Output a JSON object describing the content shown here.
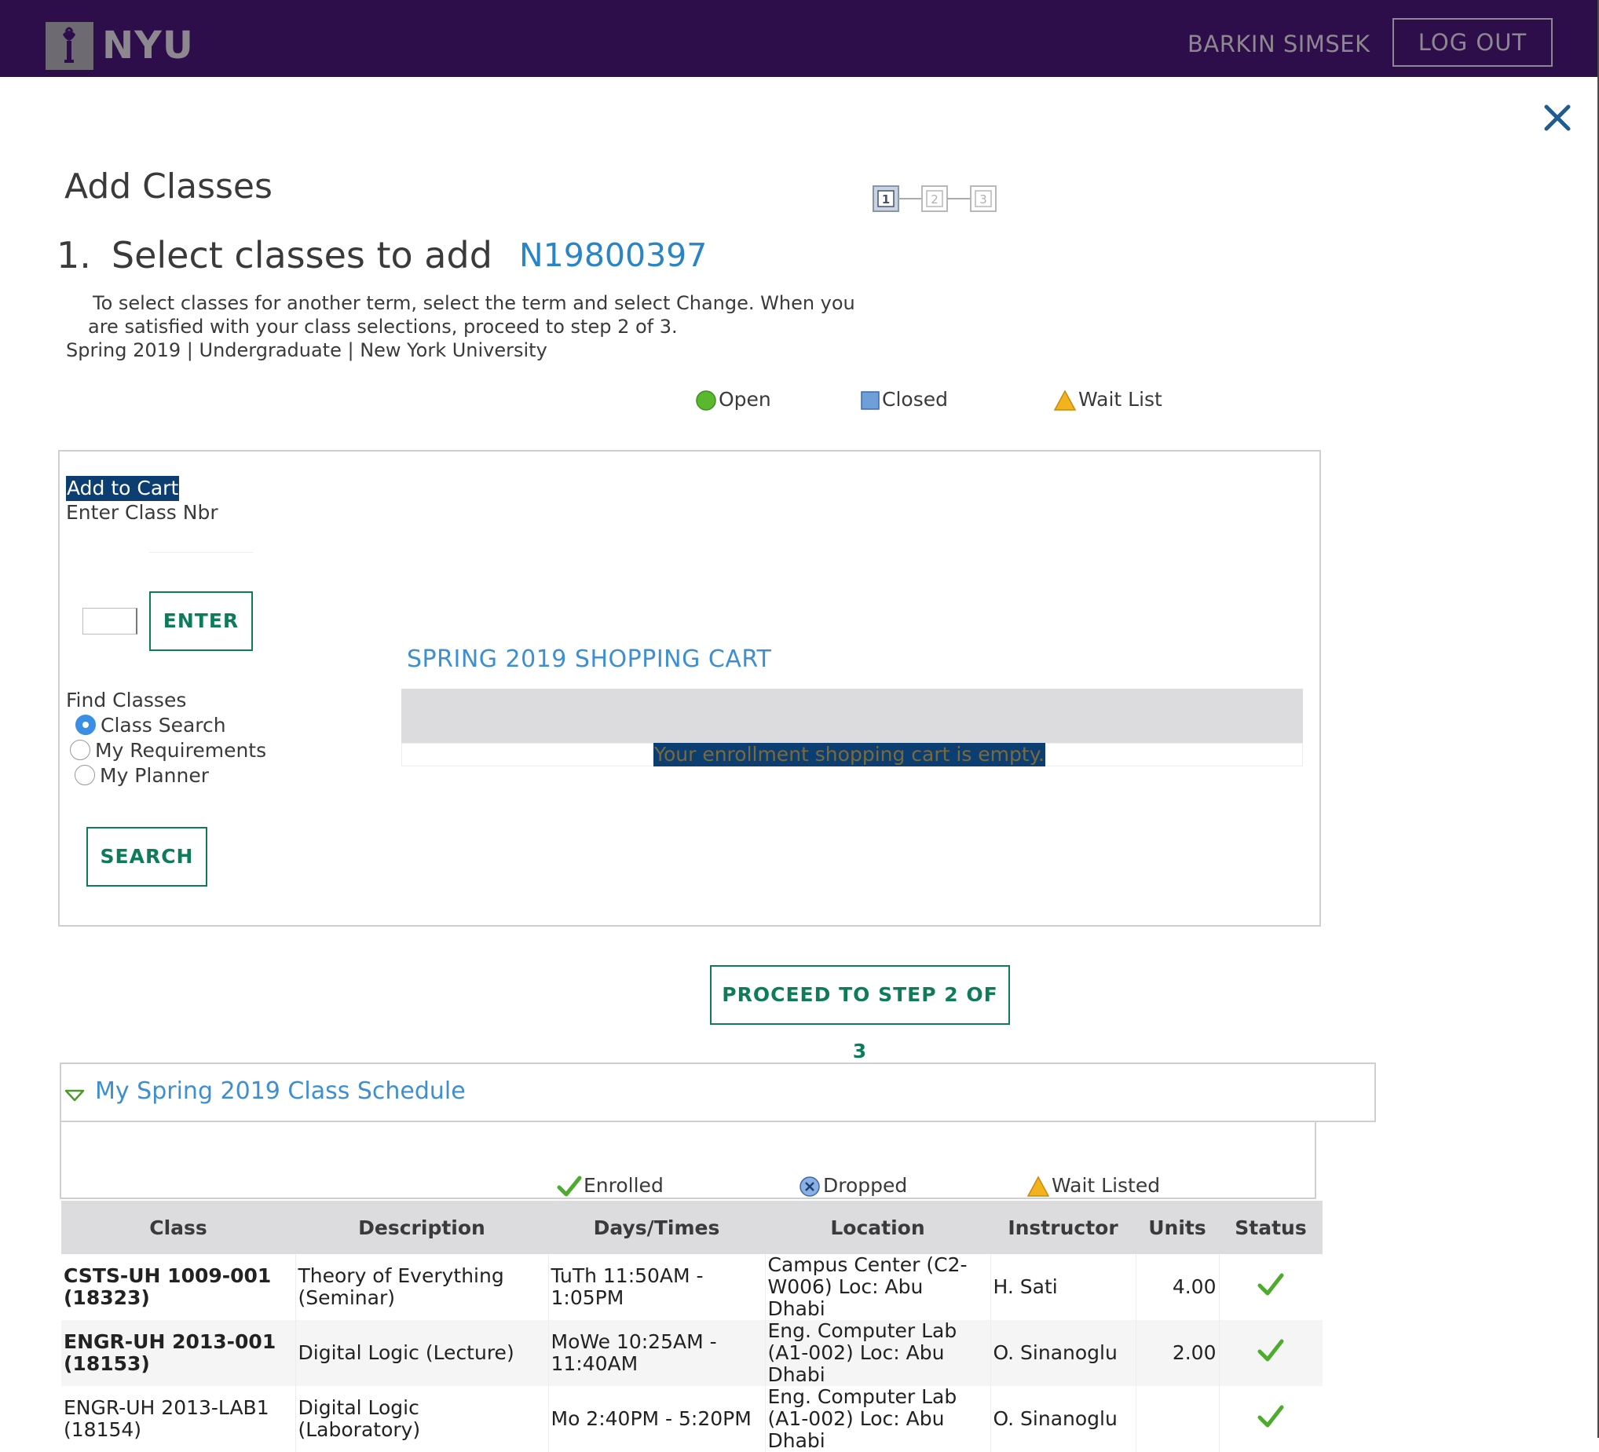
{
  "header": {
    "logo_text": "NYU",
    "user_name": "BARKIN SIMSEK",
    "logout_label": "LOG OUT"
  },
  "page": {
    "title": "Add Classes",
    "step_number": "1.",
    "step_heading": "Select classes to add",
    "student_id": "N19800397",
    "steps": [
      "1",
      "2",
      "3"
    ],
    "current_step": 1,
    "instructions_line1": "To select classes for another term, select the term and select Change.  When you",
    "instructions_line2": "are satisfied with your class selections, proceed to step 2 of 3.",
    "term_line": "Spring 2019 | Undergraduate | New York University"
  },
  "status_legend": {
    "open": "Open",
    "closed": "Closed",
    "wait_list": "Wait List",
    "open_color": "#5ab82e",
    "closed_color": "#6f9fd8",
    "wait_list_color": "#f2b31f"
  },
  "add_to_cart": {
    "label": "Add to Cart",
    "enter_class_label": "Enter Class Nbr",
    "class_nbr_value": "",
    "enter_button": "ENTER"
  },
  "find_classes": {
    "label": "Find Classes",
    "options": [
      {
        "label": "Class Search",
        "selected": true
      },
      {
        "label": "My Requirements",
        "selected": false
      },
      {
        "label": "My Planner",
        "selected": false
      }
    ],
    "search_button": "SEARCH"
  },
  "shopping_cart": {
    "title": "SPRING 2019 SHOPPING CART",
    "empty_message": "Your enrollment shopping cart is empty."
  },
  "proceed_button": "PROCEED TO STEP 2 OF 3",
  "schedule": {
    "title": "My Spring 2019 Class Schedule",
    "legend": {
      "enrolled": "Enrolled",
      "dropped": "Dropped",
      "wait_listed": "Wait Listed"
    },
    "columns": [
      "Class",
      "Description",
      "Days/Times",
      "Location",
      "Instructor",
      "Units",
      "Status"
    ],
    "rows": [
      {
        "class_line1": "CSTS-UH 1009-001",
        "class_line2": "(18323)",
        "description_line1": "Theory of Everything",
        "description_line2": "(Seminar)",
        "days_times_line1": "TuTh 11:50AM -",
        "days_times_line2": "1:05PM",
        "location_line1": "Campus Center (C2-",
        "location_line2": "W006) Loc: Abu",
        "location_line3": "Dhabi",
        "instructor": "H. Sati",
        "units": "4.00",
        "status": "enrolled"
      },
      {
        "class_line1": "ENGR-UH 2013-001",
        "class_line2": "(18153)",
        "description_line1": "Digital Logic (Lecture)",
        "description_line2": "",
        "days_times_line1": "MoWe 10:25AM -",
        "days_times_line2": "11:40AM",
        "location_line1": "Eng. Computer Lab",
        "location_line2": "(A1-002) Loc: Abu",
        "location_line3": "Dhabi",
        "instructor": "O. Sinanoglu",
        "units": "2.00",
        "status": "enrolled"
      },
      {
        "class_line1": "ENGR-UH 2013-LAB1",
        "class_line2": "(18154)",
        "description_line1": "Digital Logic",
        "description_line2": "(Laboratory)",
        "days_times_line1": "Mo 2:40PM - 5:20PM",
        "days_times_line2": "",
        "location_line1": "Eng. Computer Lab",
        "location_line2": "(A1-002) Loc: Abu",
        "location_line3": "Dhabi",
        "instructor": "O. Sinanoglu",
        "units": "",
        "status": "enrolled"
      }
    ]
  }
}
